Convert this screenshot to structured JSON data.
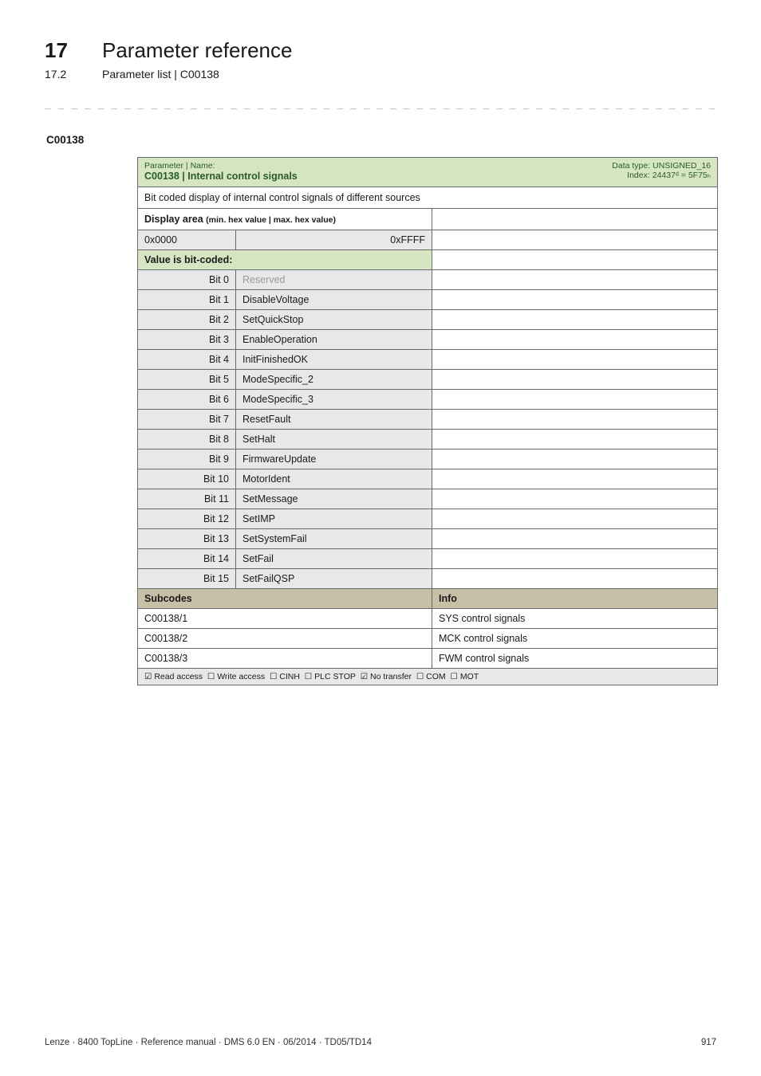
{
  "header": {
    "chapter_no": "17",
    "chapter_title": "Parameter reference",
    "section_no": "17.2",
    "section_title": "Parameter list | C00138"
  },
  "dash_rule": "_ _ _ _ _ _ _ _ _ _ _ _ _ _ _ _ _ _ _ _ _ _ _ _ _ _ _ _ _ _ _ _ _ _ _ _ _ _ _ _ _ _ _ _ _ _ _ _ _ _ _ _ _ _ _ _ _ _ _ _ _ _ _ _",
  "section_code": "C00138",
  "param_header": {
    "label": "Parameter | Name:",
    "code_name": "C00138 | Internal control signals",
    "dtype_line": "Data type: UNSIGNED_16",
    "index_line": "Index: 24437ᵈ = 5F75ₕ"
  },
  "description": "Bit coded display of internal control signals of different sources",
  "display_area": {
    "label": "Display area",
    "sublabel": "(min. hex value | max. hex value)",
    "min": "0x0000",
    "max": "0xFFFF"
  },
  "value_is_bit_coded": "Value is bit-coded:",
  "bits": [
    {
      "bit": "Bit 0",
      "name": "Reserved",
      "reserved": true
    },
    {
      "bit": "Bit 1",
      "name": "DisableVoltage",
      "reserved": false
    },
    {
      "bit": "Bit 2",
      "name": "SetQuickStop",
      "reserved": false
    },
    {
      "bit": "Bit 3",
      "name": "EnableOperation",
      "reserved": false
    },
    {
      "bit": "Bit 4",
      "name": "InitFinishedOK",
      "reserved": false
    },
    {
      "bit": "Bit 5",
      "name": "ModeSpecific_2",
      "reserved": false
    },
    {
      "bit": "Bit 6",
      "name": "ModeSpecific_3",
      "reserved": false
    },
    {
      "bit": "Bit 7",
      "name": "ResetFault",
      "reserved": false
    },
    {
      "bit": "Bit 8",
      "name": "SetHalt",
      "reserved": false
    },
    {
      "bit": "Bit 9",
      "name": "FirmwareUpdate",
      "reserved": false
    },
    {
      "bit": "Bit 10",
      "name": "MotorIdent",
      "reserved": false
    },
    {
      "bit": "Bit 11",
      "name": "SetMessage",
      "reserved": false
    },
    {
      "bit": "Bit 12",
      "name": "SetIMP",
      "reserved": false
    },
    {
      "bit": "Bit 13",
      "name": "SetSystemFail",
      "reserved": false
    },
    {
      "bit": "Bit 14",
      "name": "SetFail",
      "reserved": false
    },
    {
      "bit": "Bit 15",
      "name": "SetFailQSP",
      "reserved": false
    }
  ],
  "subcodes_header": {
    "col1": "Subcodes",
    "col2": "Info"
  },
  "subcodes": [
    {
      "code": "C00138/1",
      "info": "SYS control signals"
    },
    {
      "code": "C00138/2",
      "info": "MCK control signals"
    },
    {
      "code": "C00138/3",
      "info": "FWM control signals"
    }
  ],
  "access": {
    "read": {
      "checked": true,
      "label": "Read access"
    },
    "write": {
      "checked": false,
      "label": "Write access"
    },
    "cinh": {
      "checked": false,
      "label": "CINH"
    },
    "plcstop": {
      "checked": false,
      "label": "PLC STOP"
    },
    "notransfer": {
      "checked": true,
      "label": "No transfer"
    },
    "com": {
      "checked": false,
      "label": "COM"
    },
    "mot": {
      "checked": false,
      "label": "MOT"
    }
  },
  "footer": {
    "left": "Lenze · 8400 TopLine · Reference manual · DMS 6.0 EN · 06/2014 · TD05/TD14",
    "right": "917"
  }
}
